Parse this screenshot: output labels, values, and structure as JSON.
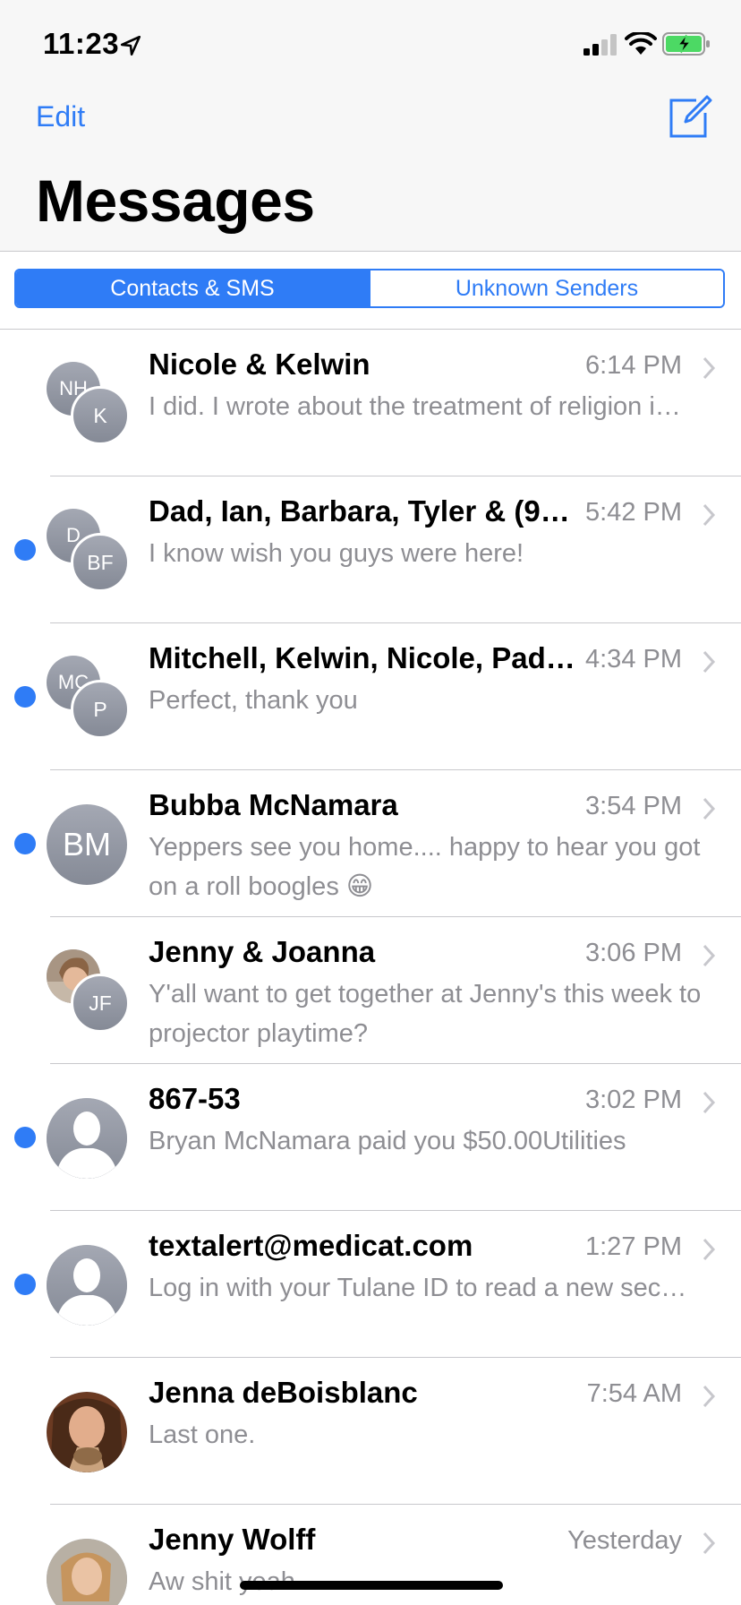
{
  "status": {
    "time": "11:23"
  },
  "nav": {
    "edit_label": "Edit",
    "title": "Messages"
  },
  "segments": [
    {
      "label": "Contacts & SMS",
      "selected": true
    },
    {
      "label": "Unknown Senders",
      "selected": false
    }
  ],
  "conversations": [
    {
      "name": "Nicole & Kelwin",
      "time": "6:14 PM",
      "preview": "I did. I wrote about the treatment of religion i…",
      "unread": false,
      "avatar_back": "NH",
      "avatar_front": "K"
    },
    {
      "name": "Dad, Ian, Barbara, Tyler & (9…",
      "time": "5:42 PM",
      "preview": "I know wish you guys were here!",
      "unread": true,
      "avatar_back": "D",
      "avatar_front": "BF"
    },
    {
      "name": "Mitchell, Kelwin, Nicole, Pad…",
      "time": "4:34 PM",
      "preview": "Perfect, thank you",
      "unread": true,
      "avatar_back": "MC",
      "avatar_front": "P"
    },
    {
      "name": "Bubba McNamara",
      "time": "3:54 PM",
      "preview": "Yeppers see you home.... happy to hear you got on a roll boogles 😁",
      "unread": true,
      "avatar": "BM"
    },
    {
      "name": "Jenny & Joanna",
      "time": "3:06 PM",
      "preview": "Y'all want to get together at Jenny's this week to projector playtime?",
      "unread": false,
      "avatar_front": "JF"
    },
    {
      "name": "867-53",
      "time": "3:02 PM",
      "preview": "Bryan McNamara paid you $50.00Utilities",
      "unread": true
    },
    {
      "name": "textalert@medicat.com",
      "time": "1:27 PM",
      "preview": "Log in with your Tulane ID to read a new sec…",
      "unread": true
    },
    {
      "name": "Jenna deBoisblanc",
      "time": "7:54 AM",
      "preview": "Last one.",
      "unread": false
    },
    {
      "name": "Jenny Wolff",
      "time": "Yesterday",
      "preview": "Aw shit yeah",
      "unread": false
    }
  ]
}
